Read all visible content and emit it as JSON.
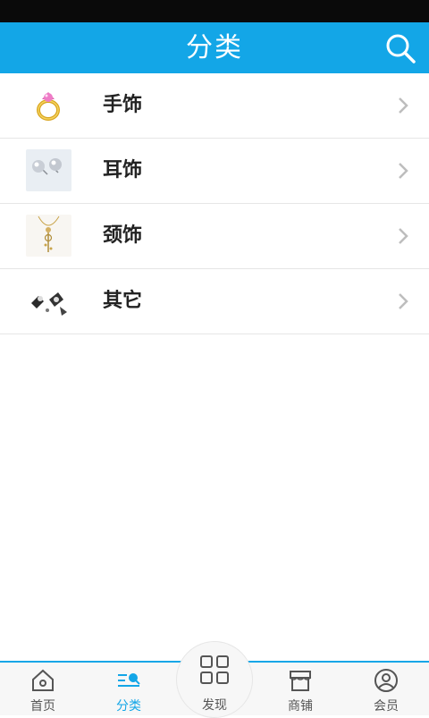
{
  "header": {
    "title": "分类",
    "search_icon": "search-icon"
  },
  "categories": [
    {
      "label": "手饰",
      "thumb": "ring-thumbnail"
    },
    {
      "label": "耳饰",
      "thumb": "pearl-earrings-thumbnail"
    },
    {
      "label": "颈饰",
      "thumb": "necklace-thumbnail"
    },
    {
      "label": "其它",
      "thumb": "brooch-thumbnail"
    }
  ],
  "tabbar": {
    "tabs": [
      {
        "label": "首页",
        "icon": "home-icon",
        "active": false
      },
      {
        "label": "分类",
        "icon": "category-icon",
        "active": true
      },
      {
        "label": "发现",
        "icon": "grid-icon",
        "active": false
      },
      {
        "label": "商铺",
        "icon": "shop-icon",
        "active": false
      },
      {
        "label": "会员",
        "icon": "user-icon",
        "active": false
      }
    ]
  },
  "colors": {
    "accent": "#13a6e7",
    "statusbar": "#0a0a0a",
    "text": "#222222"
  }
}
